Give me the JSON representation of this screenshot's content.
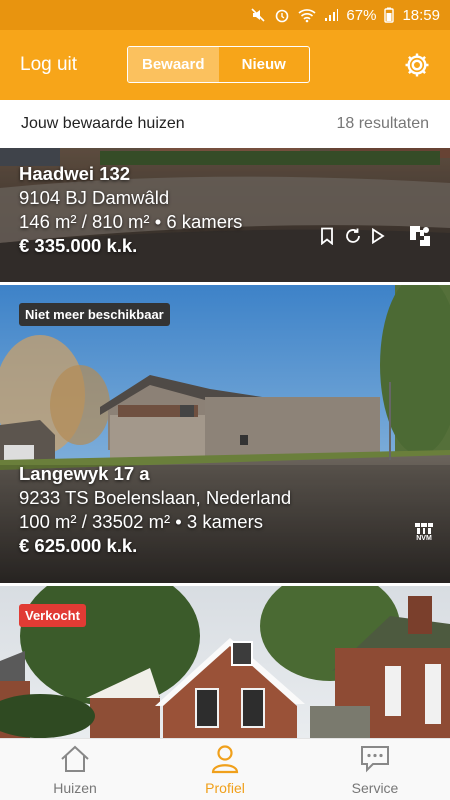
{
  "status_bar": {
    "battery": "67%",
    "time": "18:59"
  },
  "header": {
    "logout_label": "Log uit",
    "tabs": [
      {
        "label": "Bewaard",
        "active": true
      },
      {
        "label": "Nieuw",
        "active": false
      }
    ]
  },
  "subheader": {
    "title": "Jouw bewaarde huizen",
    "count": "18 resultaten"
  },
  "listings": [
    {
      "street": "Haadwei 132",
      "postal_city": "9104 BJ  Damwâld",
      "specs": "146 m² / 810 m² • 6 kamers",
      "price": "€ 335.000 k.k."
    },
    {
      "badge": "Niet meer beschikbaar",
      "street": "Langewyk 17 a",
      "postal_city": "9233 TS  Boelenslaan, Nederland",
      "specs": "100 m² / 33502 m² • 3 kamers",
      "price": "€ 625.000 k.k.",
      "logo": "NVM"
    },
    {
      "badge": "Verkocht"
    }
  ],
  "colors": {
    "brand": "#f7a519",
    "status_bar": "#e8940f",
    "badge_dark": "#333333",
    "badge_sold": "#e13b34"
  },
  "bottom_nav": [
    {
      "label": "Huizen",
      "icon": "house-icon",
      "active": false
    },
    {
      "label": "Profiel",
      "icon": "user-icon",
      "active": true
    },
    {
      "label": "Service",
      "icon": "chat-icon",
      "active": false
    }
  ]
}
